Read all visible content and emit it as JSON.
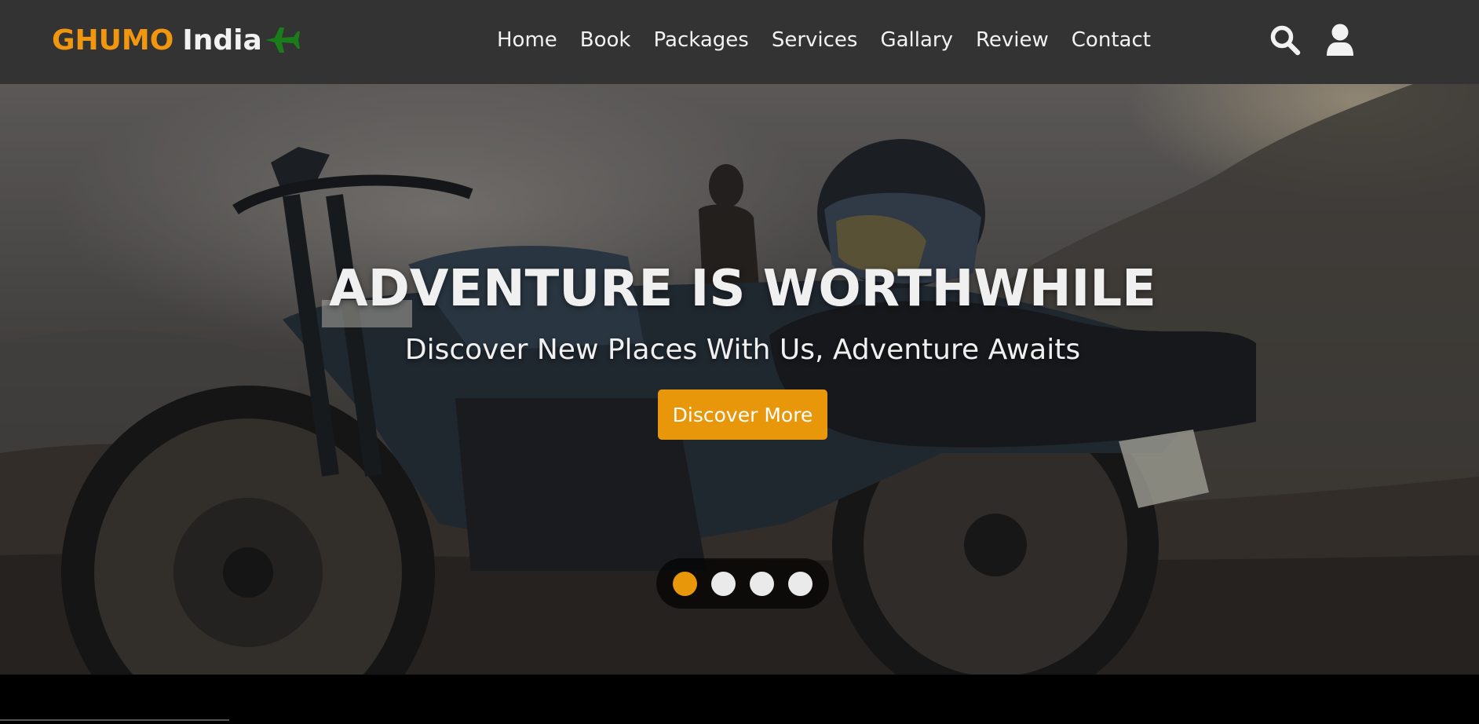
{
  "header": {
    "logo": {
      "brand": "GHUMO",
      "rest": "India",
      "icon": "plane-icon"
    },
    "nav": [
      "Home",
      "Book",
      "Packages",
      "Services",
      "Gallary",
      "Review",
      "Contact"
    ],
    "icons": [
      "search-icon",
      "user-icon"
    ]
  },
  "hero": {
    "title": "ADVENTURE IS WORTHWHILE",
    "subtitle": "Discover New Places With Us, Adventure Awaits",
    "button": "Discover More",
    "slides": {
      "count": 4,
      "active": 1
    }
  },
  "colors": {
    "header_bg": "#333333",
    "accent": "#e8960a",
    "logo_plane": "#1a7d1a",
    "text": "#f2f2f2"
  }
}
